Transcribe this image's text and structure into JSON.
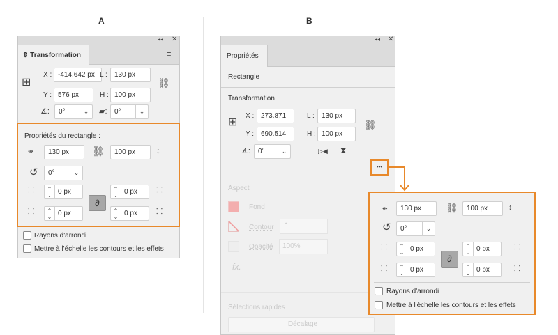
{
  "labels": {
    "a": "A",
    "b": "B"
  },
  "panel_a": {
    "tab": "Transformation",
    "x_label": "X :",
    "x": "-414.642 px",
    "l_label": "L :",
    "l": "130 px",
    "y_label": "Y :",
    "y": "576 px",
    "h_label": "H :",
    "h": "100 px",
    "angle": "0°",
    "shear": "0°",
    "rect_title": "Propriétés du rectangle :",
    "rect_width": "130 px",
    "rect_height": "100 px",
    "rotation": "0°",
    "corners": [
      "0 px",
      "0 px",
      "0 px",
      "0 px"
    ],
    "checkbox_rounded": "Rayons d'arrondi",
    "checkbox_scale": "Mettre à l'échelle les contours et les effets"
  },
  "panel_b": {
    "tab": "Propriétés",
    "object": "Rectangle",
    "section": "Transformation",
    "x_label": "X :",
    "x": "273.871 px",
    "l_label": "L :",
    "l": "130 px",
    "y_label": "Y :",
    "y": "690.514 px",
    "h_label": "H :",
    "h": "100 px",
    "angle": "0°",
    "more": "•••",
    "aspect": "Aspect",
    "fill": "Fond",
    "stroke": "Contour",
    "opacity_label": "Opacité",
    "opacity": "100%",
    "fx": "fx.",
    "quick": "Sélections rapides",
    "offset_button": "Décalage"
  },
  "popup": {
    "rect_width": "130 px",
    "rect_height": "100 px",
    "rotation": "0°",
    "corners": [
      "0 px",
      "0 px",
      "0 px",
      "0 px"
    ],
    "checkbox_rounded": "Rayons d'arrondi",
    "checkbox_scale": "Mettre à l'échelle les contours et les effets"
  },
  "colors": {
    "highlight": "#e8892b",
    "fill_swatch": "#f4a3a3"
  }
}
